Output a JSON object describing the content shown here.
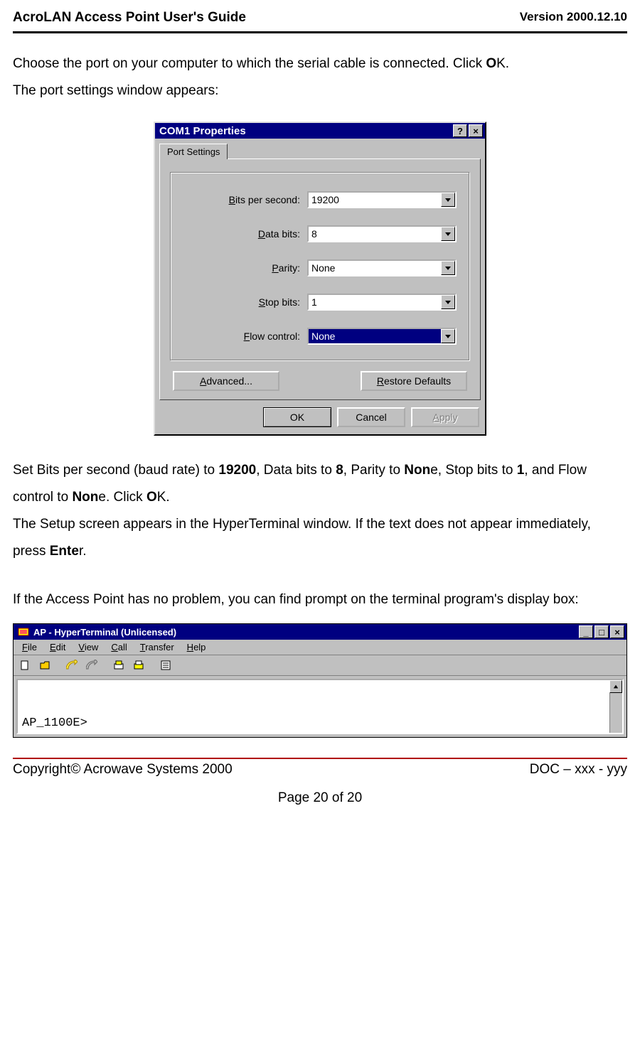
{
  "header": {
    "title": "AcroLAN Access Point User's Guide",
    "version": "Version 2000.12.10"
  },
  "para1_a": "Choose the port on your computer to which the serial cable is connected. Click ",
  "para1_b_bold": "O",
  "para1_c": "K.",
  "para1_line2": "The port settings window appears:",
  "dialog": {
    "title": "COM1 Properties",
    "tab": "Port Settings",
    "fields": {
      "bits_label_pre": "B",
      "bits_label_rest": "its per second:",
      "bits_value": "19200",
      "data_label_pre": "D",
      "data_label_rest": "ata bits:",
      "data_value": "8",
      "parity_label_pre": "P",
      "parity_label_rest": "arity:",
      "parity_value": "None",
      "stop_label_pre": "S",
      "stop_label_rest": "top bits:",
      "stop_value": "1",
      "flow_label_pre": "F",
      "flow_label_rest": "low control:",
      "flow_value": "None"
    },
    "advanced_pre": "A",
    "advanced_rest": "dvanced...",
    "restore_pre": "R",
    "restore_rest": "estore Defaults",
    "ok": "OK",
    "cancel": "Cancel",
    "apply_pre": "A",
    "apply_rest": "pply"
  },
  "para2_a": "Set Bits per second (baud rate) to ",
  "para2_b": "19200",
  "para2_c": ", Data bits to ",
  "para2_d": "8",
  "para2_e": ", Parity to ",
  "para2_f": "Non",
  "para2_g": "e, Stop bits to ",
  "para2_h": "1",
  "para2_i": ", and Flow control to ",
  "para2_j": "Non",
  "para2_k": "e. Click ",
  "para2_l": "O",
  "para2_m": "K.",
  "para3_a": "The Setup screen appears in the HyperTerminal window. If the text does not appear immediately, press ",
  "para3_b": "Ente",
  "para3_c": "r.",
  "para4": "If the Access Point has no problem, you can find prompt on the terminal program's display box:",
  "hyper": {
    "title": "AP - HyperTerminal (Unlicensed)",
    "menus": {
      "file_u": "F",
      "file_r": "ile",
      "edit_u": "E",
      "edit_r": "dit",
      "view_u": "V",
      "view_r": "iew",
      "call_u": "C",
      "call_r": "all",
      "transfer_u": "T",
      "transfer_r": "ransfer",
      "help_u": "H",
      "help_r": "elp"
    },
    "prompt": "AP_1100E>"
  },
  "footer": {
    "copyright": "Copyright© Acrowave Systems 2000",
    "doc": "DOC – xxx - yyy",
    "page": "Page 20 of 20"
  }
}
